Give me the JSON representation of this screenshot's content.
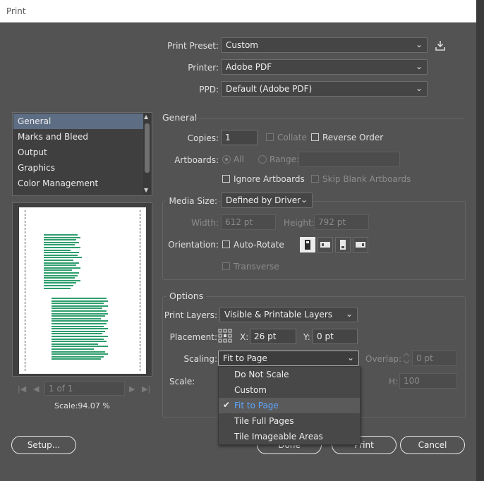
{
  "window": {
    "title": "Print"
  },
  "preset": {
    "print_preset_label": "Print Preset:",
    "print_preset_value": "Custom",
    "printer_label": "Printer:",
    "printer_value": "Adobe PDF",
    "ppd_label": "PPD:",
    "ppd_value": "Default (Adobe PDF)"
  },
  "sidebar": {
    "items": [
      {
        "label": "General"
      },
      {
        "label": "Marks and Bleed"
      },
      {
        "label": "Output"
      },
      {
        "label": "Graphics"
      },
      {
        "label": "Color Management"
      }
    ]
  },
  "preview": {
    "scale_text": "Scale:94.07 %",
    "page_field": "1 of 1"
  },
  "general": {
    "heading": "General",
    "copies_label": "Copies:",
    "copies_value": "1",
    "collate_label": "Collate",
    "reverse_order_label": "Reverse Order",
    "artboards_label": "Artboards:",
    "all_label": "All",
    "range_label": "Range:",
    "ignore_artboards_label": "Ignore Artboards",
    "skip_blank_label": "Skip Blank Artboards"
  },
  "media": {
    "size_label": "Media Size:",
    "size_value": "Defined by Driver",
    "width_label": "Width:",
    "width_value": "612 pt",
    "height_label": "Height:",
    "height_value": "792 pt",
    "orientation_label": "Orientation:",
    "auto_rotate_label": "Auto-Rotate",
    "transverse_label": "Transverse"
  },
  "options": {
    "heading": "Options",
    "print_layers_label": "Print Layers:",
    "print_layers_value": "Visible & Printable Layers",
    "placement_label": "Placement:",
    "x_label": "X:",
    "x_value": "26 pt",
    "y_label": "Y:",
    "y_value": "0 pt",
    "scaling_label": "Scaling:",
    "scaling_value": "Fit to Page",
    "overlap_label": "Overlap:",
    "overlap_value": "0 pt",
    "scale_label": "Scale:",
    "h_label": "H:",
    "h_value": "100"
  },
  "scaling_menu": {
    "items": [
      {
        "label": "Do Not Scale"
      },
      {
        "label": "Custom"
      },
      {
        "label": "Fit to Page"
      },
      {
        "label": "Tile Full Pages"
      },
      {
        "label": "Tile Imageable Areas"
      }
    ],
    "check_glyph": "✔"
  },
  "buttons": {
    "setup": "Setup...",
    "done": "Done",
    "print": "Print",
    "cancel": "Cancel"
  },
  "icons": {
    "save_preset": "download-icon",
    "chevron": "chevron-down-icon"
  },
  "colors": {
    "dialog_bg": "#535353",
    "selection": "#5d6e84",
    "accent_text": "#5ea7ff",
    "preview_text": "#2f9e6d"
  }
}
